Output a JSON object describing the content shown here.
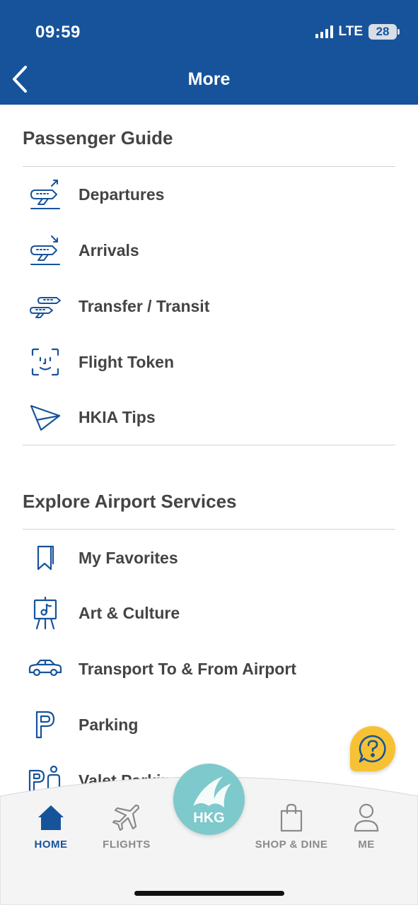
{
  "status_bar": {
    "time": "09:59",
    "network": "LTE",
    "battery": "28"
  },
  "header": {
    "title": "More",
    "back_icon": "chevron-left-icon"
  },
  "sections": [
    {
      "title": "Passenger Guide",
      "items": [
        {
          "label": "Departures",
          "icon": "plane-departure-icon"
        },
        {
          "label": "Arrivals",
          "icon": "plane-arrival-icon"
        },
        {
          "label": "Transfer / Transit",
          "icon": "plane-transfer-icon"
        },
        {
          "label": "Flight Token",
          "icon": "face-scan-icon"
        },
        {
          "label": "HKIA Tips",
          "icon": "paper-plane-icon"
        }
      ]
    },
    {
      "title": "Explore Airport Services",
      "items": [
        {
          "label": "My Favorites",
          "icon": "bookmark-icon"
        },
        {
          "label": "Art & Culture",
          "icon": "easel-icon"
        },
        {
          "label": "Transport To & From Airport",
          "icon": "car-icon"
        },
        {
          "label": "Parking",
          "icon": "parking-icon"
        },
        {
          "label": "Valet Parking",
          "icon": "valet-parking-icon"
        }
      ]
    }
  ],
  "help_button": {
    "icon": "help-chat-icon"
  },
  "tab_bar": {
    "tabs": [
      {
        "label": "HOME",
        "icon": "home-icon",
        "active": true
      },
      {
        "label": "FLIGHTS",
        "icon": "airplane-icon",
        "active": false
      },
      {
        "label": "SHOP & DINE",
        "icon": "shopping-bag-icon",
        "active": false
      },
      {
        "label": "ME",
        "icon": "person-icon",
        "active": false
      }
    ],
    "center": {
      "label": "HKG",
      "icon": "hkg-logo-icon"
    }
  },
  "colors": {
    "brand_blue": "#17539b",
    "accent_yellow": "#f6c233",
    "logo_teal": "#7ec9cc"
  }
}
